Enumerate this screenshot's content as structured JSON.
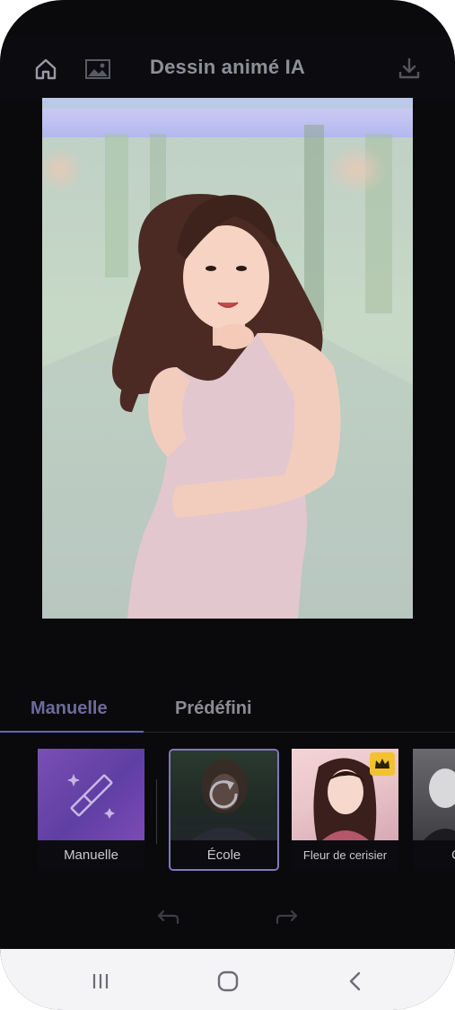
{
  "header": {
    "title": "Dessin animé IA",
    "home_icon": "home-icon",
    "gallery_icon": "gallery-icon",
    "download_icon": "download-icon"
  },
  "preview": {
    "description_icon": "photo-preview"
  },
  "tabs": [
    {
      "label": "Manuelle",
      "active": true
    },
    {
      "label": "Prédéfini",
      "active": false
    }
  ],
  "styles": [
    {
      "label": "Manuelle",
      "icon": "magic-wand-icon"
    },
    {
      "label": "École",
      "selected": true,
      "icon": "refresh-icon"
    },
    {
      "label": "Fleur de cerisier",
      "badge_icon": "crown-icon"
    },
    {
      "label": "C"
    }
  ],
  "history": {
    "undo_icon": "undo-icon",
    "redo_icon": "redo-icon"
  },
  "system_nav": {
    "recents_icon": "recents-icon",
    "home_icon": "home-circle-icon",
    "back_icon": "back-icon"
  },
  "colors": {
    "accent": "#6a63b0",
    "background": "#0a0a0c",
    "crown_badge": "#f2c230"
  }
}
